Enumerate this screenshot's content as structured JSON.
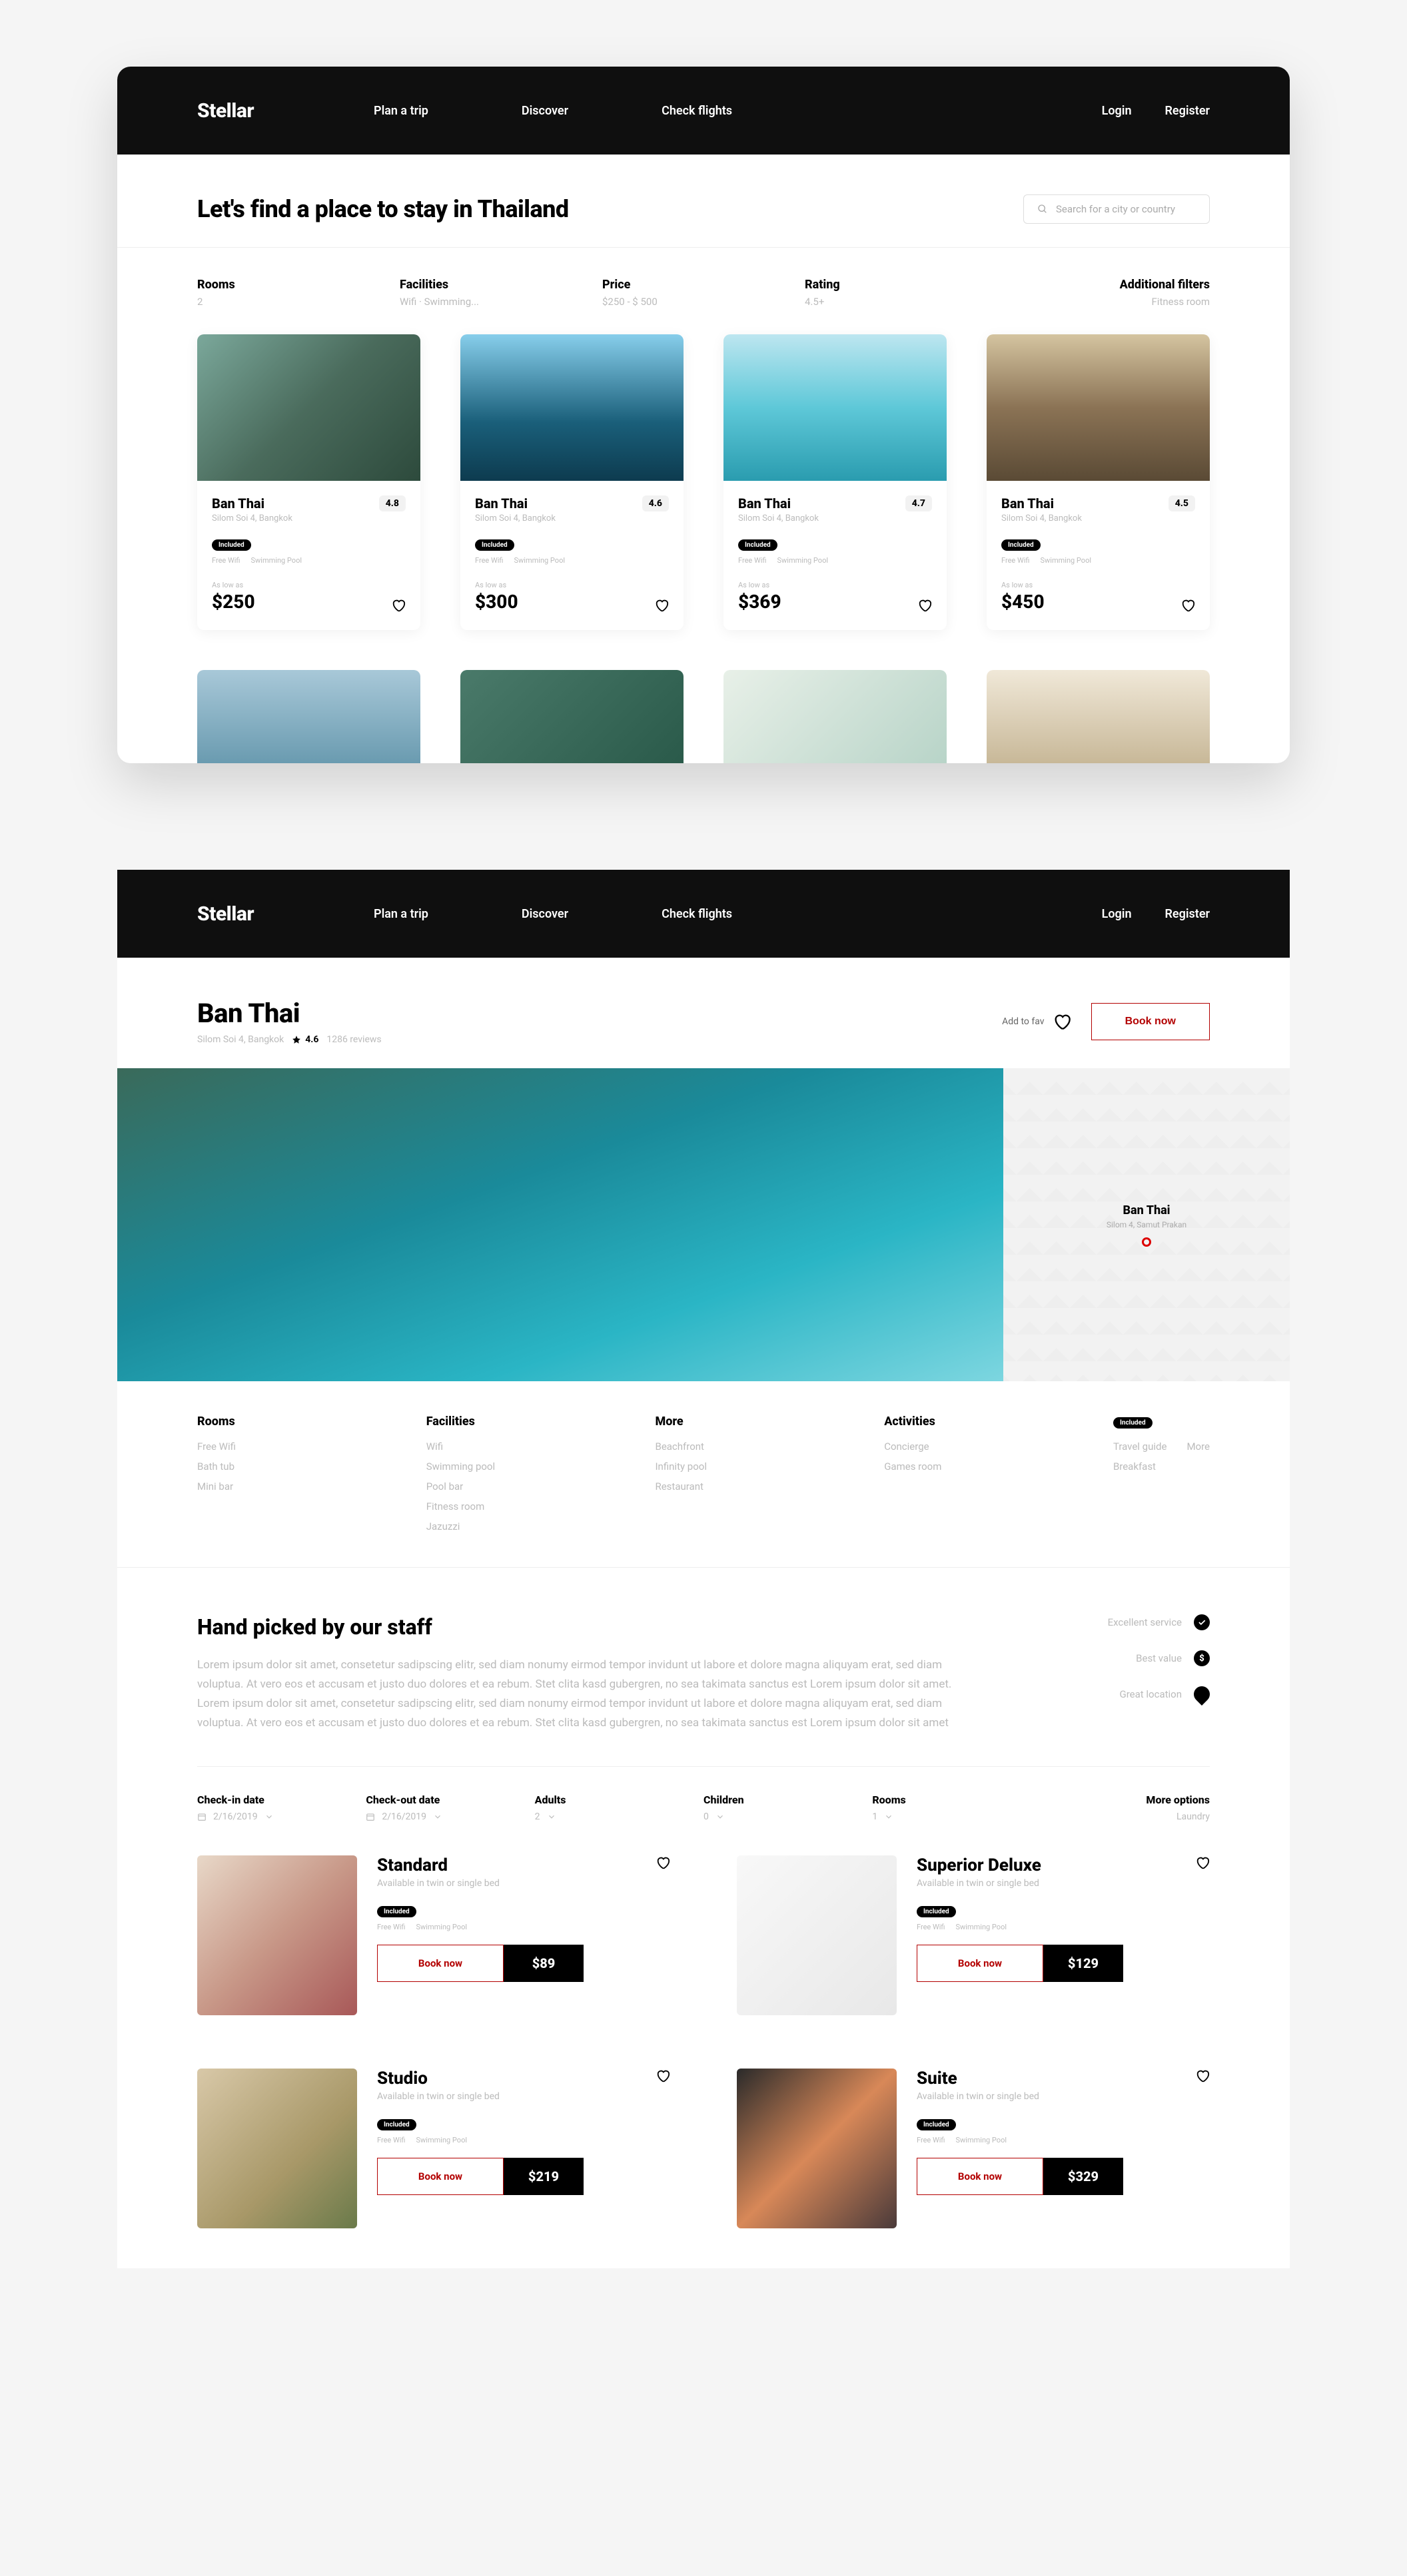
{
  "page_label": "Hotel search\nBooking",
  "brand": "Stellar",
  "nav": {
    "links": [
      "Plan a trip",
      "Discover",
      "Check flights"
    ],
    "login": "Login",
    "register": "Register"
  },
  "search_page": {
    "title": "Let's find a place to stay in Thailand",
    "search_placeholder": "Search for a city or country",
    "filters": {
      "rooms": {
        "label": "Rooms",
        "value": "2"
      },
      "facilities": {
        "label": "Facilities",
        "value": "Wifi · Swimming..."
      },
      "price": {
        "label": "Price",
        "value": "$250 - $ 500"
      },
      "rating": {
        "label": "Rating",
        "value": "4.5+"
      },
      "additional": {
        "label": "Additional filters",
        "value": "Fitness room"
      }
    },
    "cards": [
      {
        "name": "Ban Thai",
        "address": "Silom Soi 4, Bangkok",
        "rating": "4.8",
        "included_badge": "Included",
        "included": [
          "Free Wifi",
          "Swimming Pool"
        ],
        "as_low_as": "As low as",
        "price": "$250"
      },
      {
        "name": "Ban Thai",
        "address": "Silom Soi 4, Bangkok",
        "rating": "4.6",
        "included_badge": "Included",
        "included": [
          "Free Wifi",
          "Swimming Pool"
        ],
        "as_low_as": "As low as",
        "price": "$300"
      },
      {
        "name": "Ban Thai",
        "address": "Silom Soi 4, Bangkok",
        "rating": "4.7",
        "included_badge": "Included",
        "included": [
          "Free Wifi",
          "Swimming Pool"
        ],
        "as_low_as": "As low as",
        "price": "$369"
      },
      {
        "name": "Ban Thai",
        "address": "Silom Soi 4, Bangkok",
        "rating": "4.5",
        "included_badge": "Included",
        "included": [
          "Free Wifi",
          "Swimming Pool"
        ],
        "as_low_as": "As low as",
        "price": "$450"
      }
    ]
  },
  "detail_page": {
    "title": "Ban Thai",
    "address": "Silom Soi 4, Bangkok",
    "rating": "4.6",
    "reviews": "1286 reviews",
    "add_to_fav": "Add to fav",
    "book_now": "Book now",
    "map": {
      "name": "Ban Thai",
      "address": "Silom 4, Samut Prakan"
    },
    "amenities": {
      "rooms": {
        "label": "Rooms",
        "items": [
          "Free Wifi",
          "Bath tub",
          "Mini bar"
        ]
      },
      "facilities": {
        "label": "Facilities",
        "items": [
          "Wifi",
          "Swimming pool",
          "Pool bar",
          "Fitness room",
          "Jazuzzi"
        ]
      },
      "more": {
        "label": "More",
        "items": [
          "Beachfront",
          "Infinity pool",
          "Restaurant"
        ]
      },
      "activities": {
        "label": "Activities",
        "items": [
          "Concierge",
          "Games room"
        ]
      },
      "right": {
        "badge": "Included",
        "items": [
          [
            "Travel guide",
            "More"
          ],
          [
            "Breakfast",
            ""
          ]
        ]
      }
    },
    "handpicked": {
      "title": "Hand picked by our staff",
      "desc": "Lorem ipsum dolor sit amet, consetetur sadipscing elitr, sed diam nonumy eirmod tempor invidunt ut labore et dolore magna aliquyam erat, sed diam voluptua. At vero eos et accusam et justo duo dolores et ea rebum. Stet clita kasd gubergren, no sea takimata sanctus est Lorem ipsum dolor sit amet. Lorem ipsum dolor sit amet, consetetur sadipscing elitr, sed diam nonumy eirmod tempor invidunt ut labore et dolore magna aliquyam erat, sed diam voluptua. At vero eos et accusam et justo duo dolores et ea rebum. Stet clita kasd gubergren, no sea takimata sanctus est Lorem ipsum dolor sit amet",
      "features": [
        "Excellent service",
        "Best value",
        "Great location"
      ]
    },
    "booking_filters": {
      "checkin": {
        "label": "Check-in date",
        "value": "2/16/2019"
      },
      "checkout": {
        "label": "Check-out date",
        "value": "2/16/2019"
      },
      "adults": {
        "label": "Adults",
        "value": "2"
      },
      "children": {
        "label": "Children",
        "value": "0"
      },
      "rooms": {
        "label": "Rooms",
        "value": "1"
      },
      "more": {
        "label": "More options",
        "value": "Laundry"
      }
    },
    "rooms": [
      {
        "name": "Standard",
        "sub": "Available in twin or single bed",
        "badge": "Included",
        "incl": [
          "Free Wifi",
          "Swimming Pool"
        ],
        "book": "Book now",
        "price": "$89"
      },
      {
        "name": "Superior Deluxe",
        "sub": "Available in twin or single bed",
        "badge": "Included",
        "incl": [
          "Free Wifi",
          "Swimming Pool"
        ],
        "book": "Book now",
        "price": "$129"
      },
      {
        "name": "Studio",
        "sub": "Available in twin or single bed",
        "badge": "Included",
        "incl": [
          "Free Wifi",
          "Swimming Pool"
        ],
        "book": "Book now",
        "price": "$219"
      },
      {
        "name": "Suite",
        "sub": "Available in twin or single bed",
        "badge": "Included",
        "incl": [
          "Free Wifi",
          "Swimming Pool"
        ],
        "book": "Book now",
        "price": "$329"
      }
    ]
  }
}
